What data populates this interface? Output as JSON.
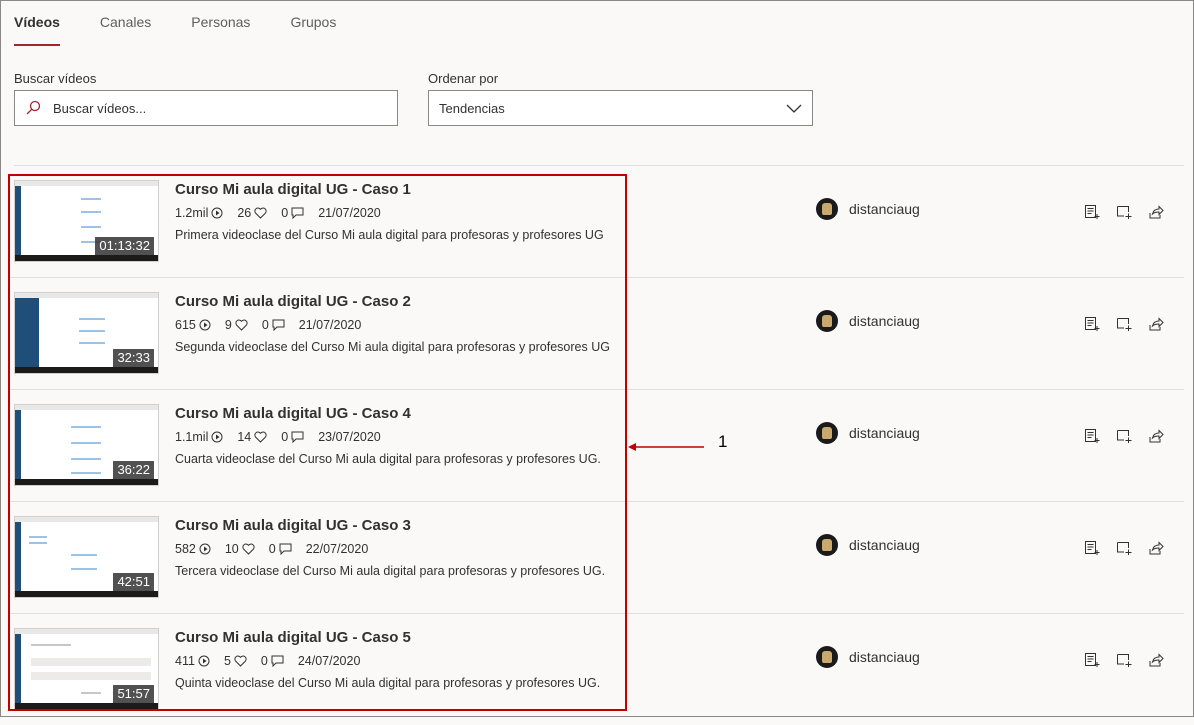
{
  "tabs": [
    {
      "label": "Vídeos",
      "active": true
    },
    {
      "label": "Canales",
      "active": false
    },
    {
      "label": "Personas",
      "active": false
    },
    {
      "label": "Grupos",
      "active": false
    }
  ],
  "search": {
    "label": "Buscar vídeos",
    "placeholder": "Buscar vídeos..."
  },
  "sort": {
    "label": "Ordenar por",
    "value": "Tendencias"
  },
  "videos": [
    {
      "title": "Curso Mi aula digital UG - Caso 1",
      "views": "1.2mil",
      "likes": "26",
      "comments": "0",
      "date": "21/07/2020",
      "description": "Primera videoclase del Curso Mi aula digital para profesoras y profesores UG",
      "duration": "01:13:32",
      "channel": "distanciaug"
    },
    {
      "title": "Curso Mi aula digital UG - Caso 2",
      "views": "615",
      "likes": "9",
      "comments": "0",
      "date": "21/07/2020",
      "description": "Segunda videoclase del Curso Mi aula digital para profesoras y profesores UG",
      "duration": "32:33",
      "channel": "distanciaug"
    },
    {
      "title": "Curso Mi aula digital UG - Caso 4",
      "views": "1.1mil",
      "likes": "14",
      "comments": "0",
      "date": "23/07/2020",
      "description": "Cuarta videoclase del Curso Mi aula digital para profesoras y profesores UG.",
      "duration": "36:22",
      "channel": "distanciaug"
    },
    {
      "title": "Curso Mi aula digital UG - Caso 3",
      "views": "582",
      "likes": "10",
      "comments": "0",
      "date": "22/07/2020",
      "description": "Tercera videoclase del Curso Mi aula digital para profesoras y profesores UG.",
      "duration": "42:51",
      "channel": "distanciaug"
    },
    {
      "title": "Curso Mi aula digital UG - Caso 5",
      "views": "411",
      "likes": "5",
      "comments": "0",
      "date": "24/07/2020",
      "description": "Quinta videoclase del Curso Mi aula digital para profesoras y profesores UG.",
      "duration": "51:57",
      "channel": "distanciaug"
    }
  ],
  "annotation": {
    "label": "1",
    "color": "#c00000"
  },
  "colors": {
    "accent": "#a4262c",
    "background": "#faf9f8"
  }
}
